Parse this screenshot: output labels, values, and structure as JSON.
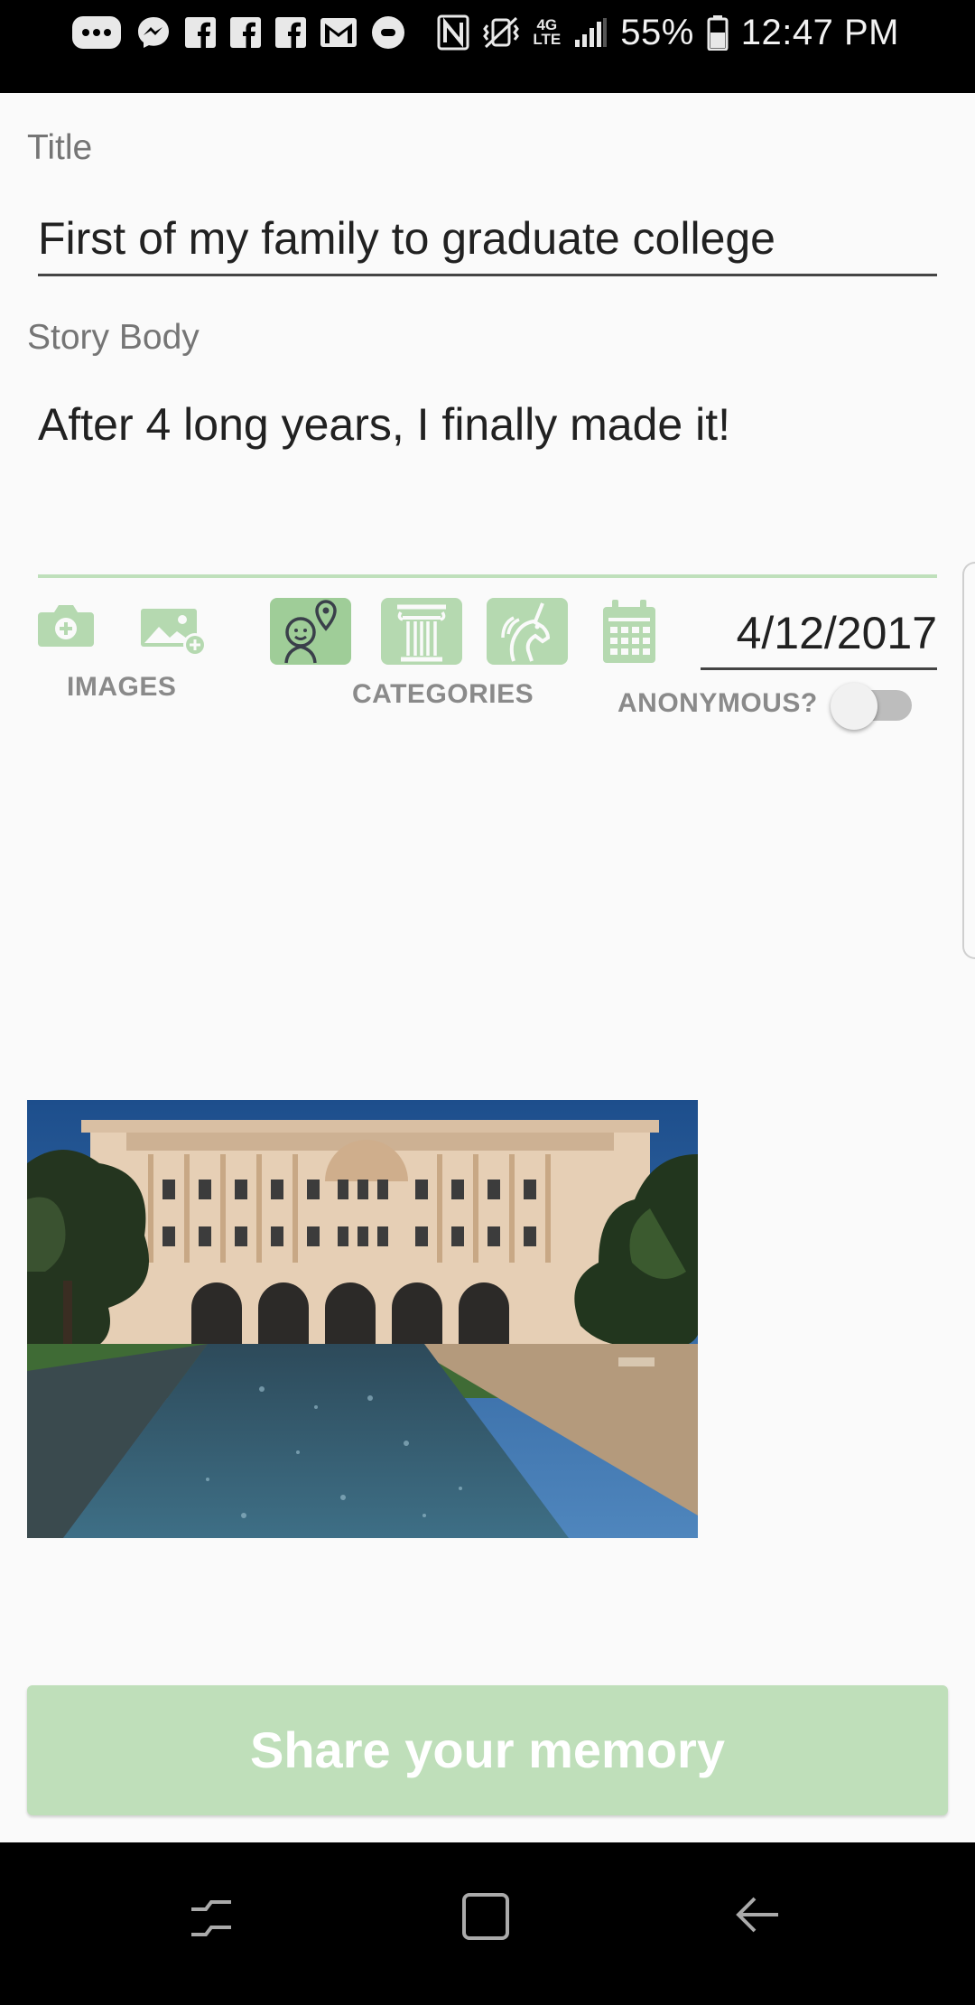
{
  "status_bar": {
    "network": "4G LTE",
    "battery": "55%",
    "time": "12:47 PM",
    "icons": [
      "chat-dots-icon",
      "messenger-icon",
      "facebook-icon",
      "facebook-icon",
      "facebook-icon",
      "gmail-icon",
      "app-icon",
      "nfc-icon",
      "vibrate-icon",
      "signal-icon",
      "battery-icon"
    ]
  },
  "form": {
    "title_label": "Title",
    "title_value": "First of my family to graduate college",
    "body_label": "Story Body",
    "body_value": "After 4 long years, I finally made it!"
  },
  "toolbar": {
    "images_label": "IMAGES",
    "categories_label": "CATEGORIES",
    "anonymous_label": "ANONYMOUS?",
    "anonymous_on": false,
    "date_value": "4/12/2017",
    "categories": [
      "people-location",
      "history-column",
      "fantasy-unicorn"
    ]
  },
  "share_button": {
    "label": "Share your memory"
  },
  "colors": {
    "accent": "#9fcd98",
    "accent_light": "#bfdfba",
    "label_grey": "#757575"
  }
}
